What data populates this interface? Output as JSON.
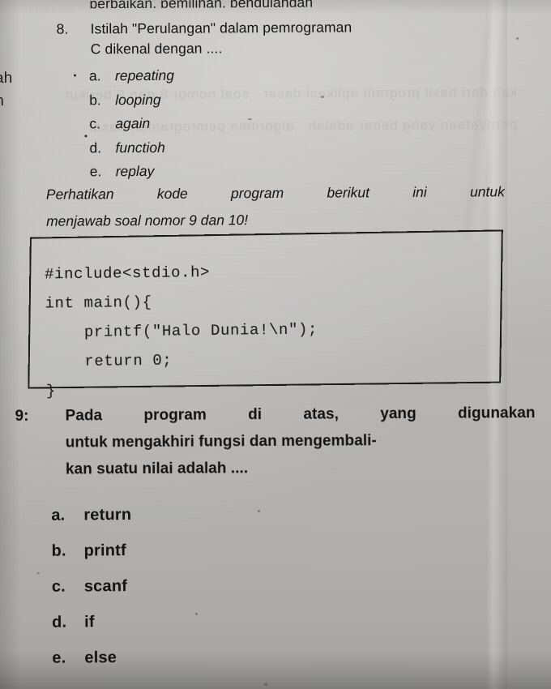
{
  "page": {
    "cut_top_line": "perbaikan, pemilihan, pengulangan",
    "margin_fragment_1": "ah",
    "margin_fragment_2": "h",
    "showthrough_text": "kan dari hasil program aplikasi dasar   soal nomor 8 dan 9 berikut   pernyataan yang benar adalah   algoritma pemrograman dasar"
  },
  "question8": {
    "number": "8.",
    "text_line1": "Istilah \"Perulangan\" dalam pemrograman",
    "text_line2": "C dikenal dengan ....",
    "options": [
      {
        "label": "a.",
        "text": "repeating"
      },
      {
        "label": "b.",
        "text": "looping"
      },
      {
        "label": "c.",
        "text": "again"
      },
      {
        "label": "d.",
        "text": "functioh"
      },
      {
        "label": "e.",
        "text": "replay"
      }
    ]
  },
  "lead_in": {
    "line1": "Perhatikan kode program berikut ini untuk",
    "line2": "menjawab soal nomor 9 dan 10!"
  },
  "code_block": {
    "lines": [
      "#include<stdio.h>",
      "int main(){",
      "    printf(\"Halo Dunia!\\n\");",
      "    return 0;",
      "}"
    ],
    "full_text": "#include<stdio.h>\nint main(){\n    printf(\"Halo Dunia!\\n\");\n    return 0;\n}"
  },
  "question9": {
    "number": "9:",
    "text_line1": "Pada program di atas, yang digunakan",
    "text_line2": "untuk mengakhiri fungsi dan mengembali-",
    "text_line3": "kan suatu nilai adalah ....",
    "options": [
      {
        "label": "a.",
        "text": "return"
      },
      {
        "label": "b.",
        "text": "printf"
      },
      {
        "label": "c.",
        "text": "scanf"
      },
      {
        "label": "d.",
        "text": "if"
      },
      {
        "label": "e.",
        "text": "else"
      }
    ]
  },
  "colors": {
    "paper": "#bcbbb9",
    "ink": "#141414",
    "box_border": "#1a1a1a"
  }
}
